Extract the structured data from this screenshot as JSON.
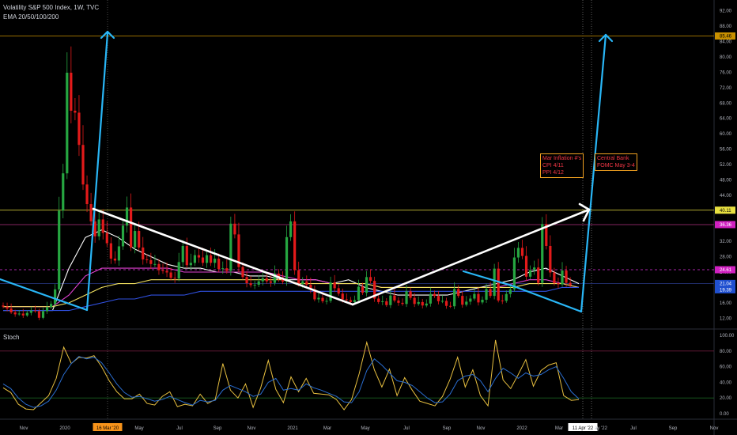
{
  "header": {
    "symbol_line": "Volatility S&P 500 Index, 1W, TVC",
    "indicator_line": "EMA 20/50/100/200",
    "osc_label": "Stoch"
  },
  "notes": [
    {
      "text": "Mar Inflation #'s\nCPI 4/11\nPPI 4/12"
    },
    {
      "text": "Central Bank\nFOMC May 3-4"
    }
  ],
  "colors": {
    "background": "#000000",
    "up": "#26a641",
    "down": "#e31a1a",
    "ema20": "#ffffff",
    "ema50": "#e040d0",
    "ema100": "#f0e060",
    "ema200": "#3050e0",
    "stoch_k": "#e8c040",
    "stoch_d": "#2a6dd0",
    "blue_arrow": "#29b6f6",
    "white_line": "#ffffff",
    "level_40": "#e8e040",
    "level_85": "#c89000",
    "level_36": "#b03080",
    "level_24": "#e030e0"
  },
  "chart_data": {
    "type": "candlestick",
    "title": "Volatility S&P 500 Index, 1W, TVC",
    "indicators": [
      "EMA 20",
      "EMA 50",
      "EMA 100",
      "EMA 200",
      "Stoch"
    ],
    "y_ticks": [
      "92.00",
      "88.00",
      "85.46",
      "84.00",
      "80.00",
      "76.00",
      "72.00",
      "68.00",
      "64.00",
      "60.00",
      "56.00",
      "52.00",
      "48.00",
      "44.00",
      "40.00",
      "36.00",
      "32.00",
      "28.00",
      "24.00",
      "20.00",
      "16.00",
      "12.00"
    ],
    "x_ticks": [
      "Nov",
      "2020",
      "16 Mar '20",
      "May",
      "Jul",
      "Sep",
      "Nov",
      "2021",
      "Mar",
      "May",
      "Jul",
      "Sep",
      "Nov",
      "2022",
      "Mar",
      "11 Apr '22",
      "ay '22",
      "Jul",
      "Sep",
      "Nov"
    ],
    "price_labels": [
      {
        "text": "85.46",
        "value": 85.46,
        "color": "#c89000"
      },
      {
        "text": "40.11",
        "value": 40.11,
        "color": "#e8e040"
      },
      {
        "text": "36.36",
        "value": 36.36,
        "color": "#d020c0"
      },
      {
        "text": "24.61",
        "value": 24.61,
        "color": "#d020c0"
      },
      {
        "text": "21.04",
        "value": 21.04,
        "color": "#2050d0"
      },
      {
        "text": "19.39",
        "value": 19.39,
        "color": "#2050d0"
      }
    ],
    "horizontal_levels": [
      85.46,
      40.11,
      36.36,
      24.61,
      21.04
    ],
    "vix_close": [
      15,
      14.5,
      13.5,
      13,
      13.2,
      12.7,
      13.4,
      14,
      13.8,
      12.1,
      13.8,
      14.9,
      15.7,
      19.5,
      40,
      49.7,
      75.9,
      66,
      65.5,
      57.1,
      46.8,
      41.7,
      37.2,
      33.3,
      37.7,
      34.2,
      31.5,
      27.5,
      27,
      30.7,
      36.1,
      40.8,
      30.4,
      34.7,
      30.4,
      27.3,
      27.1,
      26.1,
      26.1,
      24.5,
      24.3,
      23.9,
      22.5,
      22.3,
      26.6,
      30.8,
      25.8,
      26.4,
      28.4,
      27.8,
      26.4,
      28.4,
      26.4,
      27.5,
      24.8,
      25,
      24.3,
      36.6,
      33.8,
      25.3,
      22.7,
      21.1,
      20.6,
      20.7,
      21.6,
      22.4,
      21.6,
      21.2,
      23.6,
      22.6,
      21.5,
      33.1,
      37.2,
      24.5,
      20.9,
      21.6,
      20.7,
      19.5,
      16.9,
      17.3,
      16.4,
      16.5,
      21.3,
      19.8,
      18.4,
      16.9,
      16.7,
      16.2,
      16.7,
      20.2,
      18.6,
      22.7,
      21.7,
      17.1,
      16.2,
      16.4,
      15.4,
      17.9,
      16.6,
      16,
      15.7,
      19,
      17.3,
      15.7,
      16.2,
      15.3,
      15.8,
      18.3,
      17.8,
      16.4,
      16.5,
      15.2,
      15.1,
      19.6,
      17.8,
      15.5,
      16.3,
      17.1,
      18.3,
      16.1,
      16.8,
      19.6,
      17.8,
      24.9,
      16.6,
      16.5,
      18.3,
      19.5,
      27.8,
      30.3,
      28.2,
      22.8,
      24.5,
      25.2,
      21.2,
      36.5,
      30.8,
      23.9,
      21.1,
      20.8,
      24.4,
      21.2,
      20.6
    ],
    "stoch_k": [
      33,
      27,
      12,
      6,
      5,
      14,
      23,
      45,
      85,
      64,
      72,
      71,
      74,
      60,
      42,
      28,
      19,
      19,
      25,
      13,
      11,
      22,
      28,
      9,
      12,
      10,
      25,
      13,
      18,
      64,
      30,
      20,
      38,
      8,
      33,
      68,
      31,
      14,
      47,
      28,
      45,
      26,
      25,
      24,
      18,
      5,
      18,
      51,
      91,
      56,
      34,
      57,
      23,
      46,
      30,
      16,
      13,
      10,
      22,
      44,
      72,
      34,
      56,
      23,
      10,
      94,
      43,
      32,
      50,
      69,
      35,
      55,
      62,
      65,
      23,
      17,
      18
    ],
    "stoch_d": [
      38,
      32,
      20,
      12,
      8,
      10,
      16,
      30,
      50,
      64,
      73,
      70,
      72,
      65,
      52,
      38,
      27,
      21,
      22,
      19,
      16,
      18,
      22,
      18,
      14,
      11,
      17,
      15,
      17,
      30,
      36,
      32,
      28,
      22,
      25,
      40,
      45,
      30,
      32,
      30,
      38,
      33,
      30,
      26,
      22,
      15,
      14,
      28,
      55,
      70,
      62,
      52,
      42,
      40,
      36,
      28,
      20,
      14,
      15,
      25,
      42,
      48,
      50,
      42,
      28,
      45,
      58,
      52,
      45,
      52,
      48,
      50,
      56,
      60,
      45,
      28,
      19
    ],
    "ema_values": {
      "ema20": [
        14,
        14,
        14,
        14,
        25,
        33,
        35,
        33,
        30,
        28,
        26,
        25,
        25,
        24,
        24,
        23,
        23,
        22,
        22,
        22,
        21,
        22,
        20,
        19,
        18,
        18,
        18,
        18,
        19,
        20,
        21,
        22,
        24,
        25,
        23,
        21
      ],
      "ema50": [
        15,
        15,
        15,
        15,
        18,
        23,
        25,
        25,
        25,
        25,
        25,
        24,
        24,
        24,
        24,
        24,
        24,
        23,
        22,
        22,
        21,
        21,
        21,
        20,
        20,
        20,
        20,
        20,
        20,
        20,
        20,
        21,
        22,
        22,
        21,
        20
      ],
      "ema100": [
        15,
        15,
        15,
        15,
        16,
        18,
        20,
        21,
        21,
        22,
        22,
        22,
        22,
        22,
        22,
        22,
        22,
        22,
        21,
        21,
        21,
        21,
        21,
        20,
        20,
        20,
        20,
        20,
        20,
        20,
        20,
        20,
        21,
        21,
        21,
        20
      ],
      "ema200": [
        14,
        14,
        14,
        14,
        14,
        15,
        16,
        17,
        17,
        18,
        18,
        18,
        19,
        19,
        19,
        19,
        19,
        19,
        19,
        19,
        19,
        19,
        19,
        19,
        19,
        19,
        19,
        19,
        19,
        19,
        19,
        19,
        19,
        19,
        20,
        20
      ]
    },
    "stoch_ticks": [
      "100.00",
      "80.00",
      "60.00",
      "40.00",
      "20.00",
      "0.00"
    ],
    "annotations": [
      "Mar Inflation #'s / CPI 4/11 / PPI 4/12",
      "Central Bank / FOMC May 3-4"
    ],
    "ylim": [
      10,
      94
    ],
    "grid": false,
    "legend": "top-left"
  }
}
